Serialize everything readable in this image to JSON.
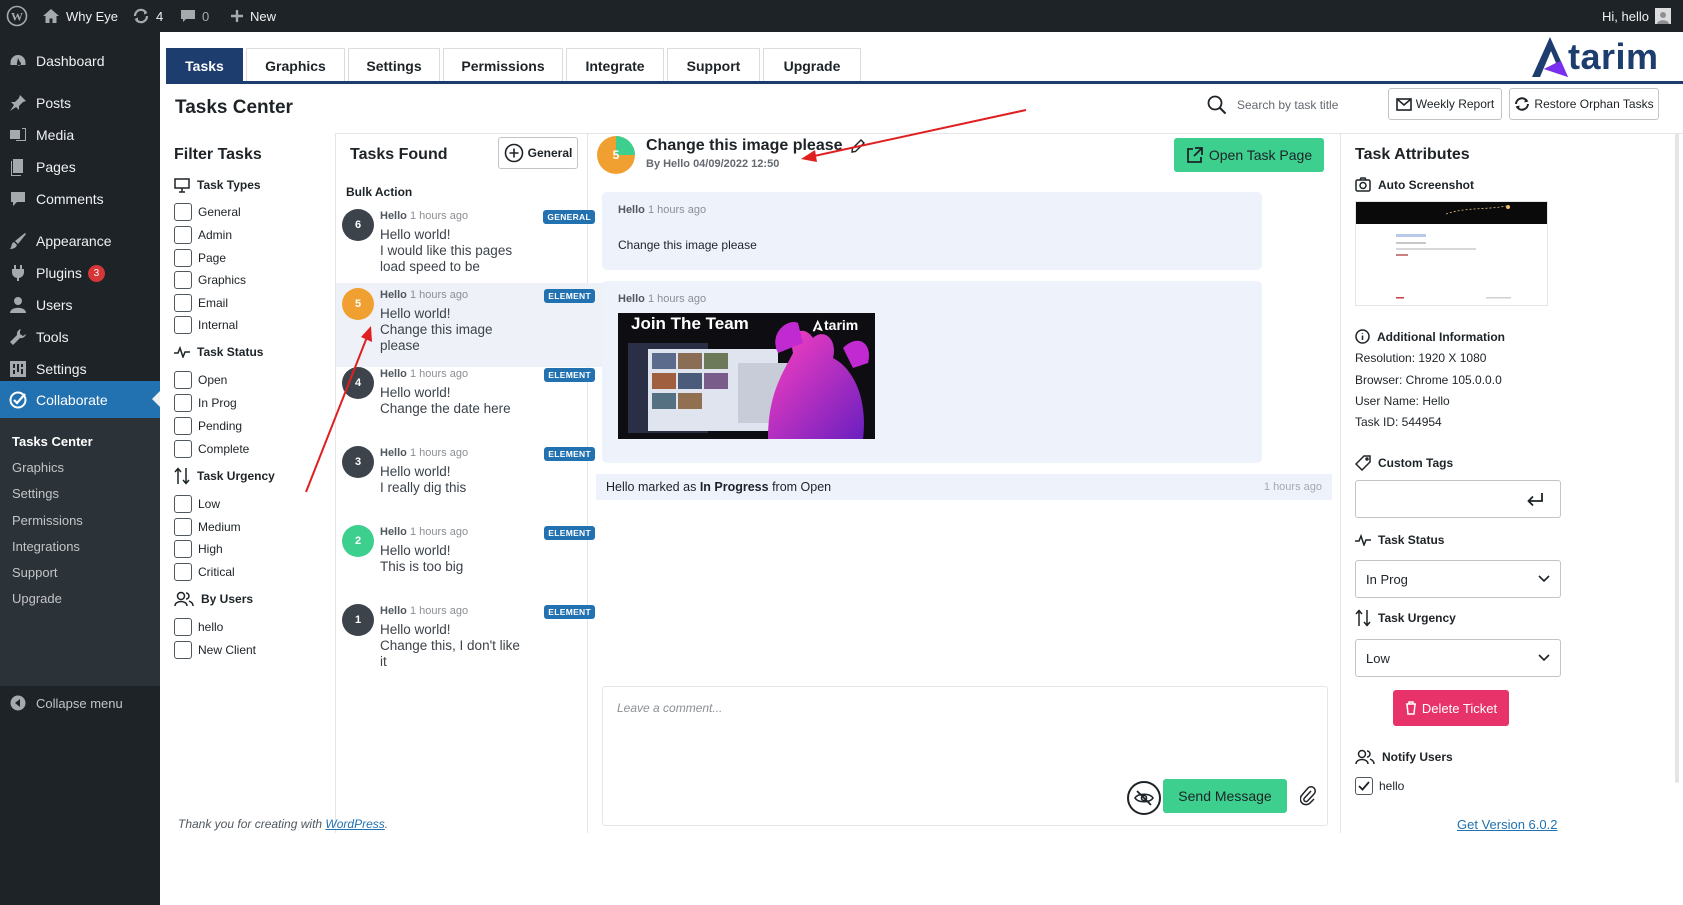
{
  "admin_bar": {
    "site_name": "Why Eye",
    "updates_count": "4",
    "comments_count": "0",
    "new_label": "New",
    "greeting": "Hi, hello"
  },
  "sidebar": {
    "items": [
      {
        "label": "Dashboard",
        "icon": "dashboard-icon"
      },
      {
        "label": "Posts",
        "icon": "pin-icon"
      },
      {
        "label": "Media",
        "icon": "media-icon"
      },
      {
        "label": "Pages",
        "icon": "pages-icon"
      },
      {
        "label": "Comments",
        "icon": "comment-icon"
      },
      {
        "label": "Appearance",
        "icon": "brush-icon"
      },
      {
        "label": "Plugins",
        "icon": "plugin-icon",
        "badge": "3"
      },
      {
        "label": "Users",
        "icon": "user-icon"
      },
      {
        "label": "Tools",
        "icon": "wrench-icon"
      },
      {
        "label": "Settings",
        "icon": "settings-icon"
      },
      {
        "label": "Collaborate",
        "icon": "check-circle-icon"
      }
    ],
    "submenu": [
      "Tasks Center",
      "Graphics",
      "Settings",
      "Permissions",
      "Integrations",
      "Support",
      "Upgrade"
    ],
    "collapse_label": "Collapse menu"
  },
  "tabs": [
    "Tasks",
    "Graphics",
    "Settings",
    "Permissions",
    "Integrate",
    "Support",
    "Upgrade"
  ],
  "brand": {
    "logo_text": "tarim",
    "accent": "#1d3d6e"
  },
  "page_title": "Tasks Center",
  "search": {
    "placeholder": "Search by task title"
  },
  "buttons": {
    "weekly_report": "Weekly Report",
    "restore_orphan": "Restore Orphan Tasks",
    "general": "General",
    "open_task_page": "Open Task Page",
    "delete_ticket": "Delete Ticket",
    "send_message": "Send Message"
  },
  "filter": {
    "title": "Filter Tasks",
    "task_types_label": "Task Types",
    "task_types": [
      "General",
      "Admin",
      "Page",
      "Graphics",
      "Email",
      "Internal"
    ],
    "task_status_label": "Task Status",
    "task_status": [
      "Open",
      "In Prog",
      "Pending",
      "Complete"
    ],
    "task_urgency_label": "Task Urgency",
    "task_urgency": [
      "Low",
      "Medium",
      "High",
      "Critical"
    ],
    "by_users_label": "By Users",
    "users": [
      "hello",
      "New Client"
    ]
  },
  "tasks_list": {
    "title": "Tasks Found",
    "bulk_action": "Bulk Action",
    "items": [
      {
        "num": "6",
        "author": "Hello",
        "time": "1 hours ago",
        "type": "GENERAL",
        "line1": "Hello world!",
        "line2": "I would like this pages load speed to be",
        "color": "#3c434a"
      },
      {
        "num": "5",
        "author": "Hello",
        "time": "1 hours ago",
        "type": "ELEMENT",
        "line1": "Hello world!",
        "line2": "Change this image please",
        "color": "#f0a030"
      },
      {
        "num": "4",
        "author": "Hello",
        "time": "1 hours ago",
        "type": "ELEMENT",
        "line1": "Hello world!",
        "line2": "Change the date here",
        "color": "#3c434a"
      },
      {
        "num": "3",
        "author": "Hello",
        "time": "1 hours ago",
        "type": "ELEMENT",
        "line1": "Hello world!",
        "line2": "I really dig this",
        "color": "#3c434a"
      },
      {
        "num": "2",
        "author": "Hello",
        "time": "1 hours ago",
        "type": "ELEMENT",
        "line1": "Hello world!",
        "line2": "This is too big",
        "color": "#3ccf8e"
      },
      {
        "num": "1",
        "author": "Hello",
        "time": "1 hours ago",
        "type": "ELEMENT",
        "line1": "Hello world!",
        "line2": "Change this, I don't like it",
        "color": "#3c434a"
      }
    ]
  },
  "task_detail": {
    "num": "5",
    "title": "Change this image please",
    "meta": "By Hello 04/09/2022 12:50",
    "messages": [
      {
        "author": "Hello",
        "time": "1 hours ago",
        "text": "Change this image please"
      },
      {
        "author": "Hello",
        "time": "1 hours ago",
        "image_title": "Join The Team",
        "image_logo": "tarim"
      }
    ],
    "status_change": {
      "prefix": "Hello marked as",
      "status": "In Progress",
      "suffix": "from Open",
      "time": "1 hours ago"
    },
    "comment_placeholder": "Leave a comment..."
  },
  "attributes": {
    "title": "Task Attributes",
    "auto_screenshot_label": "Auto Screenshot",
    "additional_info_label": "Additional Information",
    "info": [
      "Resolution: 1920 X 1080",
      "Browser: Chrome 105.0.0.0",
      "User Name: Hello",
      "Task ID: 544954"
    ],
    "custom_tags_label": "Custom Tags",
    "task_status_label": "Task Status",
    "task_status_value": "In Prog",
    "task_urgency_label": "Task Urgency",
    "task_urgency_value": "Low",
    "notify_users_label": "Notify Users",
    "notify_user": "hello"
  },
  "footer": {
    "thanks_prefix": "Thank you for creating with",
    "thanks_link": "WordPress",
    "thanks_suffix": ".",
    "version": "Get Version 6.0.2"
  },
  "colors": {
    "primary_green": "#3ccf8e",
    "delete_pink": "#e8336a",
    "wp_blue": "#2271b1",
    "annotation_red": "#e02020"
  }
}
